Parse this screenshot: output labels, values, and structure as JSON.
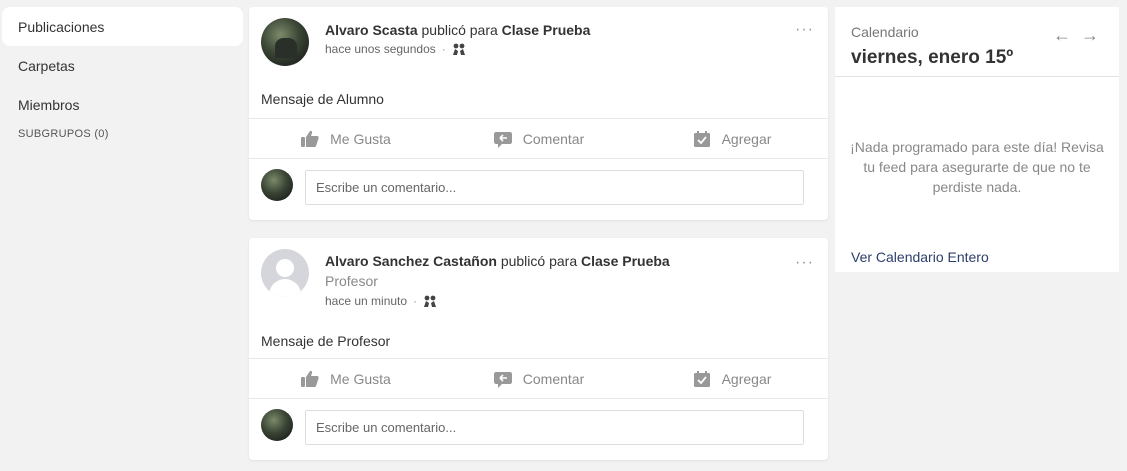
{
  "sidebar": {
    "items": [
      {
        "label": "Publicaciones"
      },
      {
        "label": "Carpetas"
      },
      {
        "label": "Miembros"
      }
    ],
    "subgroups_label": "SUBGRUPOS (0)"
  },
  "posts": [
    {
      "author": "Alvaro Scasta",
      "verb": " publicó para ",
      "target": "Clase Prueba",
      "role": "",
      "time": "hace unos segundos",
      "message": "Mensaje de Alumno",
      "like_label": "Me Gusta",
      "comment_label": "Comentar",
      "add_label": "Agregar",
      "comment_placeholder": "Escribe un comentario..."
    },
    {
      "author": "Alvaro Sanchez Castañon",
      "verb": " publicó para ",
      "target": "Clase Prueba",
      "role": "Profesor",
      "time": "hace un minuto",
      "message": "Mensaje de Profesor",
      "like_label": "Me Gusta",
      "comment_label": "Comentar",
      "add_label": "Agregar",
      "comment_placeholder": "Escribe un comentario..."
    }
  ],
  "calendar": {
    "label": "Calendario",
    "date": "viernes, enero 15º",
    "prev_icon": "←",
    "next_icon": "→",
    "empty_message": "¡Nada programado para este día! Revisa tu feed para asegurarte de que no te perdiste nada.",
    "view_all": "Ver Calendario Entero"
  },
  "icons": {
    "more": "···"
  }
}
